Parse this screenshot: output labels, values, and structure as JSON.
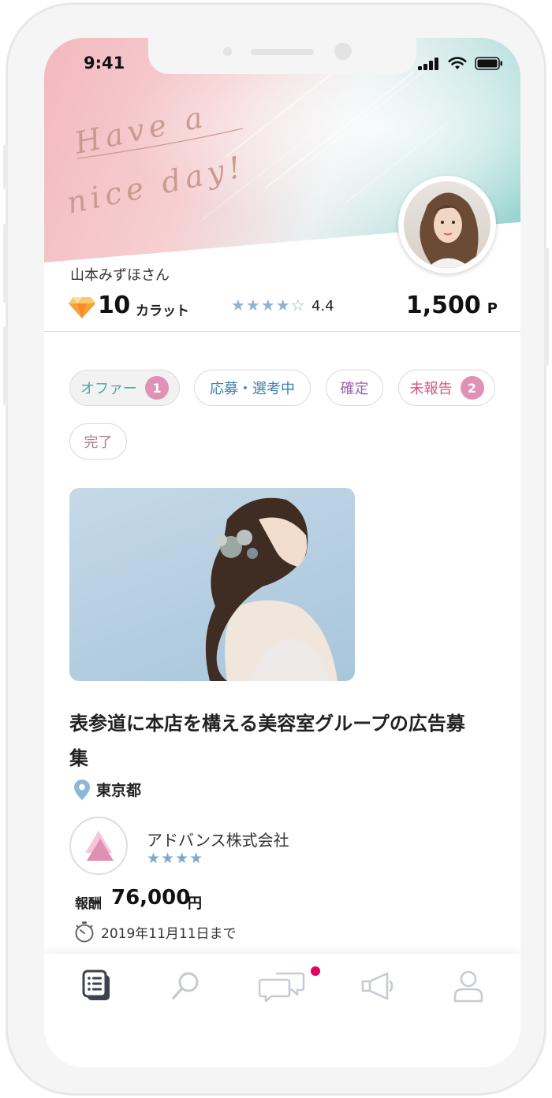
{
  "status_bar": {
    "time": "9:41"
  },
  "hero": {
    "script_line1": "Have a",
    "script_line2": "nice day!"
  },
  "profile": {
    "name": "山本みずほさん",
    "carat_value": "10",
    "carat_unit": "カラット",
    "rating_stars": "★★★★☆",
    "rating_value": "4.4",
    "points_value": "1,500",
    "points_unit": "P"
  },
  "filters": [
    {
      "label": "オファー",
      "badge": "1",
      "color": "#4aa89c"
    },
    {
      "label": "応募・選考中",
      "color": "#3b7fae"
    },
    {
      "label": "確定",
      "color": "#9a64b0"
    },
    {
      "label": "未報告",
      "badge": "2",
      "color": "#d4557f"
    },
    {
      "label": "完了",
      "color": "#b57a86"
    }
  ],
  "job": {
    "title": "表参道に本店を構える美容室グループの広告募集",
    "location": "東京都",
    "company_name": "アドバンス株式会社",
    "company_stars": "★★★★",
    "reward_label": "報酬",
    "reward_value": "76,000",
    "reward_unit": "円",
    "deadline": "2019年11月11日まで"
  },
  "tabbar": {
    "items": [
      {
        "icon": "list-icon",
        "active": true
      },
      {
        "icon": "search-icon",
        "active": false
      },
      {
        "icon": "chat-icon",
        "active": false,
        "has_notification": true
      },
      {
        "icon": "megaphone-icon",
        "active": false
      },
      {
        "icon": "user-icon",
        "active": false
      }
    ]
  },
  "colors": {
    "accent_pink": "#e091b6",
    "star_blue": "#8fb3cf",
    "notification": "#e6005f"
  }
}
